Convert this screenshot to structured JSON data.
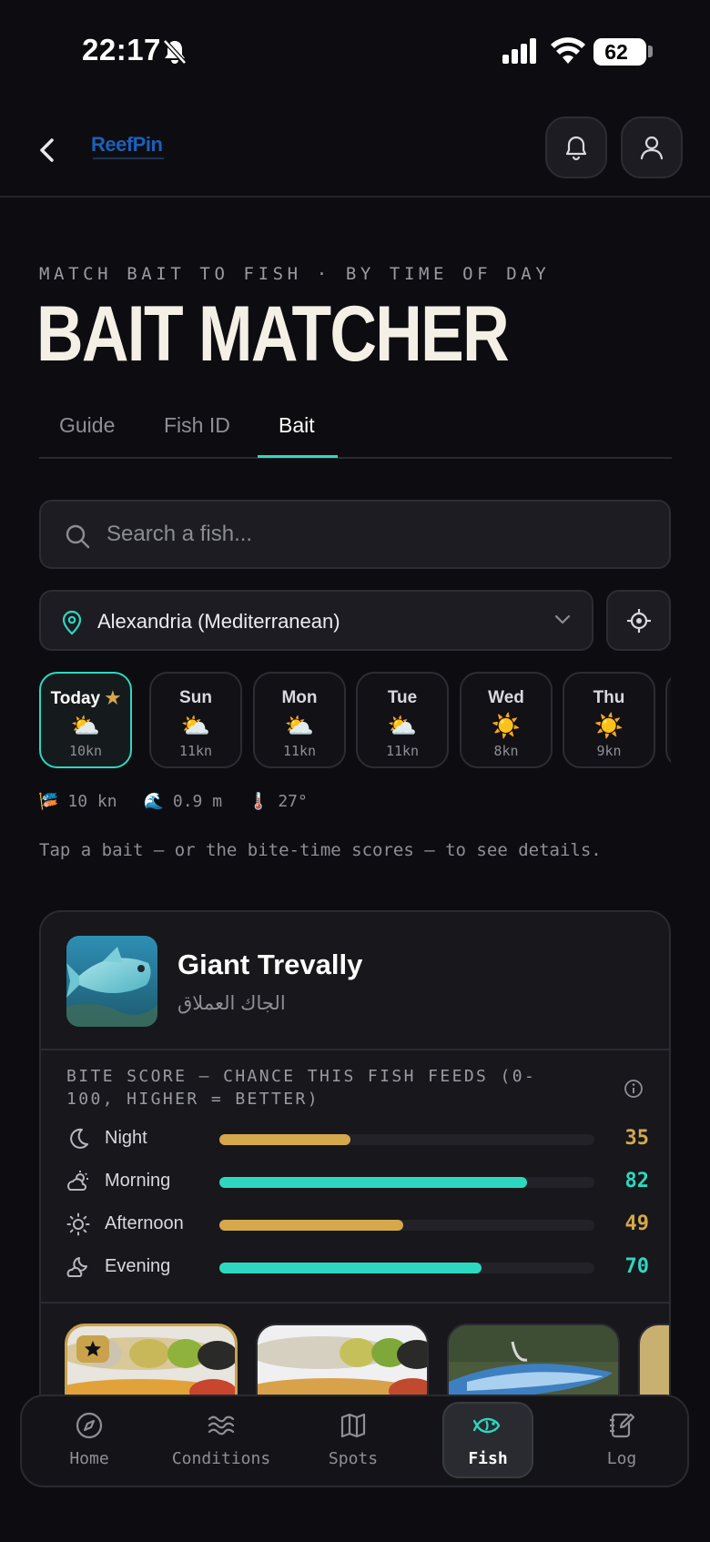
{
  "status_bar": {
    "time": "22:17",
    "battery": "62"
  },
  "header": {
    "logo_text": "ReefPin"
  },
  "page": {
    "eyebrow": "MATCH BAIT TO FISH · BY TIME OF DAY",
    "title": "BAIT MATCHER"
  },
  "tabs": [
    {
      "label": "Guide"
    },
    {
      "label": "Fish ID"
    },
    {
      "label": "Bait"
    }
  ],
  "search": {
    "placeholder": "Search a fish..."
  },
  "location": {
    "value": "Alexandria (Mediterranean)"
  },
  "days": [
    {
      "name": "Today",
      "icon": "⛅",
      "wind": "10kn",
      "starred": true
    },
    {
      "name": "Sun",
      "icon": "⛅",
      "wind": "11kn"
    },
    {
      "name": "Mon",
      "icon": "⛅",
      "wind": "11kn"
    },
    {
      "name": "Tue",
      "icon": "⛅",
      "wind": "11kn"
    },
    {
      "name": "Wed",
      "icon": "☀️",
      "wind": "8kn"
    },
    {
      "name": "Thu",
      "icon": "☀️",
      "wind": "9kn"
    }
  ],
  "conditions": {
    "wind": "10 kn",
    "wave": "0.9 m",
    "temp": "27°"
  },
  "hint": "Tap a bait — or the bite-time scores — to see details.",
  "fish": {
    "name": "Giant Trevally",
    "arabic_name": "الجاك العملاق",
    "bite_label": "BITE SCORE — CHANCE THIS FISH FEEDS (0-100, HIGHER = BETTER)",
    "bite_scores": [
      {
        "label": "Night",
        "score": 35,
        "color": "#d4a84b",
        "icon": "moon-icon"
      },
      {
        "label": "Morning",
        "score": 82,
        "color": "#2dd8c0",
        "icon": "sunrise-icon"
      },
      {
        "label": "Afternoon",
        "score": 49,
        "color": "#d4a84b",
        "icon": "sun-icon"
      },
      {
        "label": "Evening",
        "score": 70,
        "color": "#2dd8c0",
        "icon": "sunset-icon"
      }
    ]
  },
  "nav": [
    {
      "label": "Home",
      "icon": "compass-icon"
    },
    {
      "label": "Conditions",
      "icon": "waves-icon"
    },
    {
      "label": "Spots",
      "icon": "map-icon"
    },
    {
      "label": "Fish",
      "icon": "fish-icon",
      "active": true
    },
    {
      "label": "Log",
      "icon": "notebook-icon"
    }
  ],
  "colors": {
    "accent": "#2dd8c0",
    "gold": "#d4a84b",
    "background": "#0d0d11"
  }
}
